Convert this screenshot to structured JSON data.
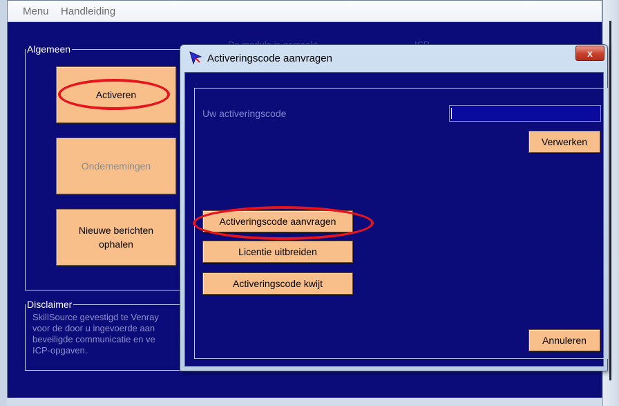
{
  "menubar": {
    "items": [
      "Menu",
      "Handleiding"
    ]
  },
  "algemeen": {
    "legend": "Algemeen",
    "buttons": {
      "activeren": "Activeren",
      "ondernemingen": "Ondernemingen",
      "nieuwe_berichten": "Nieuwe berichten\nophalen"
    }
  },
  "disclaimer": {
    "legend": "Disclaimer",
    "text": "SkillSource gevestigd te Venray\nvoor de door u ingevoerde aan\nbeveiligde communicatie en ve\nICP-opgaven."
  },
  "background_text": {
    "a": "De module is gemaakt",
    "b": "ICP"
  },
  "dialog": {
    "title": "Activeringscode aanvragen",
    "close_label": "x",
    "code_label": "Uw activeringscode",
    "code_value": "",
    "verwerken": "Verwerken",
    "aanvragen": "Activeringscode aanvragen",
    "uitbreiden": "Licentie uitbreiden",
    "kwijt": "Activeringscode kwijt",
    "annuleren": "Annuleren"
  },
  "annotations": {
    "color": "#e5141d"
  }
}
